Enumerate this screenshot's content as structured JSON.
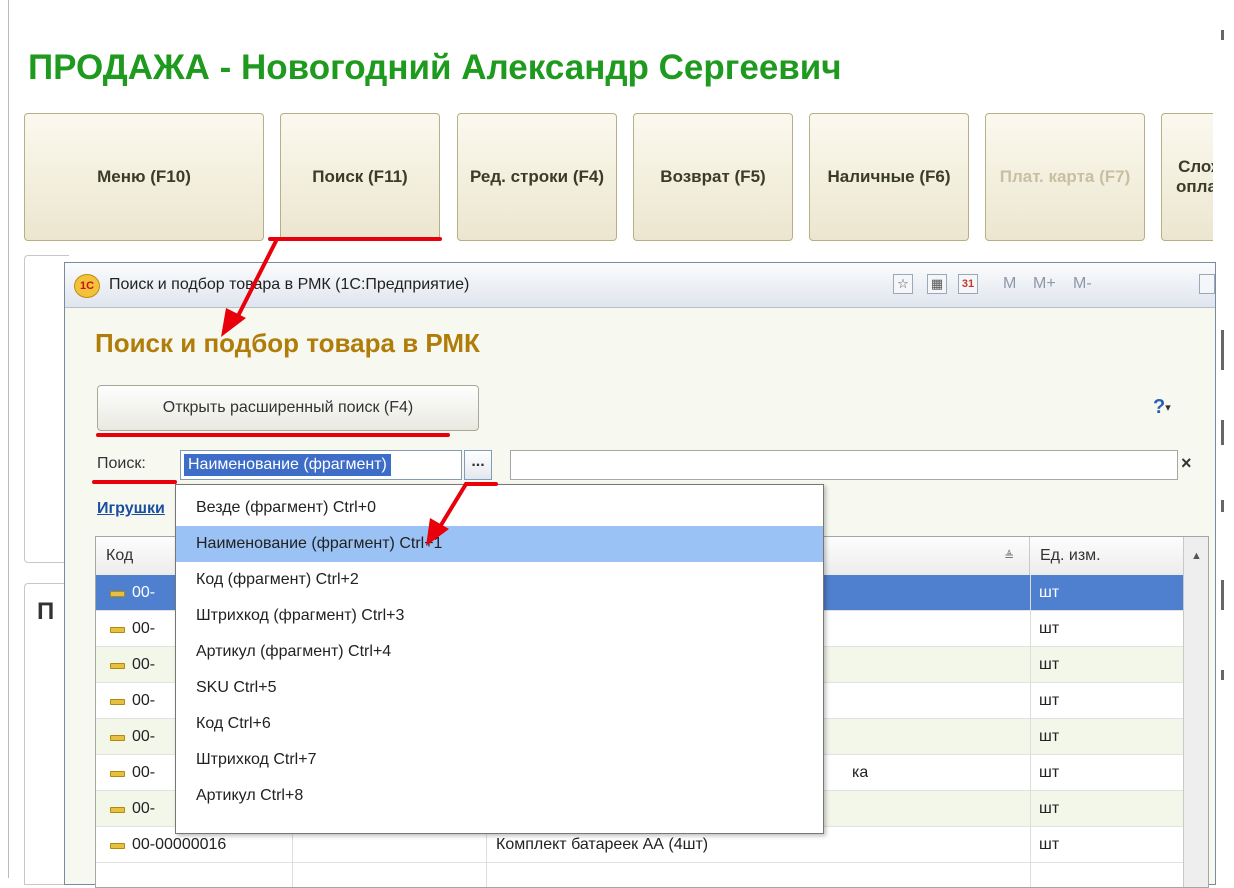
{
  "main": {
    "title": "ПРОДАЖА - Новогодний Александр Сергеевич",
    "buttons": [
      {
        "label": "Меню (F10)",
        "enabled": true
      },
      {
        "label": "Поиск (F11)",
        "enabled": true
      },
      {
        "label": "Ред. строки (F4)",
        "enabled": true
      },
      {
        "label": "Возврат (F5)",
        "enabled": true
      },
      {
        "label": "Наличные (F6)",
        "enabled": true
      },
      {
        "label": "Плат. карта (F7)",
        "enabled": false
      },
      {
        "label": "Слож оплат",
        "enabled": true
      }
    ],
    "background_panel_letter": "П"
  },
  "dialog": {
    "window_title": "Поиск и подбор товара в РМК  (1С:Предприятие)",
    "app_icon": "1С",
    "toolbar": {
      "favorite_icon": "star-icon",
      "calculator_icon": "calculator-icon",
      "calendar_icon": "calendar-icon",
      "calendar_day": "31",
      "memory": [
        "M",
        "M+",
        "M-"
      ],
      "maximize_icon": "maximize-icon"
    },
    "heading": "Поиск и подбор товара в РМК",
    "advanced_search_button": "Открыть расширенный поиск (F4)",
    "help_button": "?",
    "search": {
      "label": "Поиск:",
      "mode_value": "Наименование (фрагмент)",
      "select_button": "...",
      "input_value": "",
      "clear_button": "×"
    },
    "group_link": "Игрушки",
    "table": {
      "columns": [
        "Код",
        "",
        "",
        "Ед. изм."
      ],
      "rows": [
        {
          "code": "00-",
          "name": "",
          "unit": "шт",
          "selected": true
        },
        {
          "code": "00-",
          "name": "",
          "unit": "шт"
        },
        {
          "code": "00-",
          "name": "",
          "unit": "шт"
        },
        {
          "code": "00-",
          "name": "",
          "unit": "шт"
        },
        {
          "code": "00-",
          "name": "",
          "unit": "шт"
        },
        {
          "code": "00-",
          "name": "ка",
          "unit": "шт"
        },
        {
          "code": "00-",
          "name": "",
          "unit": "шт"
        },
        {
          "code": "00-00000016",
          "name": "Комплект батареек АА (4шт)",
          "unit": "шт"
        }
      ]
    }
  },
  "dropdown": {
    "items": [
      {
        "label": "Везде (фрагмент) Ctrl+0"
      },
      {
        "label": "Наименование (фрагмент) Ctrl+1",
        "highlighted": true
      },
      {
        "label": "Код (фрагмент) Ctrl+2"
      },
      {
        "label": "Штрихкод (фрагмент) Ctrl+3"
      },
      {
        "label": "Артикул (фрагмент) Ctrl+4"
      },
      {
        "label": "SKU  Ctrl+5"
      },
      {
        "label": "Код Ctrl+6"
      },
      {
        "label": "Штрихкод  Ctrl+7"
      },
      {
        "label": "Артикул  Ctrl+8"
      }
    ]
  },
  "annotation_color": "#e8000b",
  "colors": {
    "title_green": "#1e9a1e",
    "heading_gold": "#b07d0a",
    "selection_blue": "#4f7fcf",
    "dropdown_highlight": "#9ac2f5"
  }
}
